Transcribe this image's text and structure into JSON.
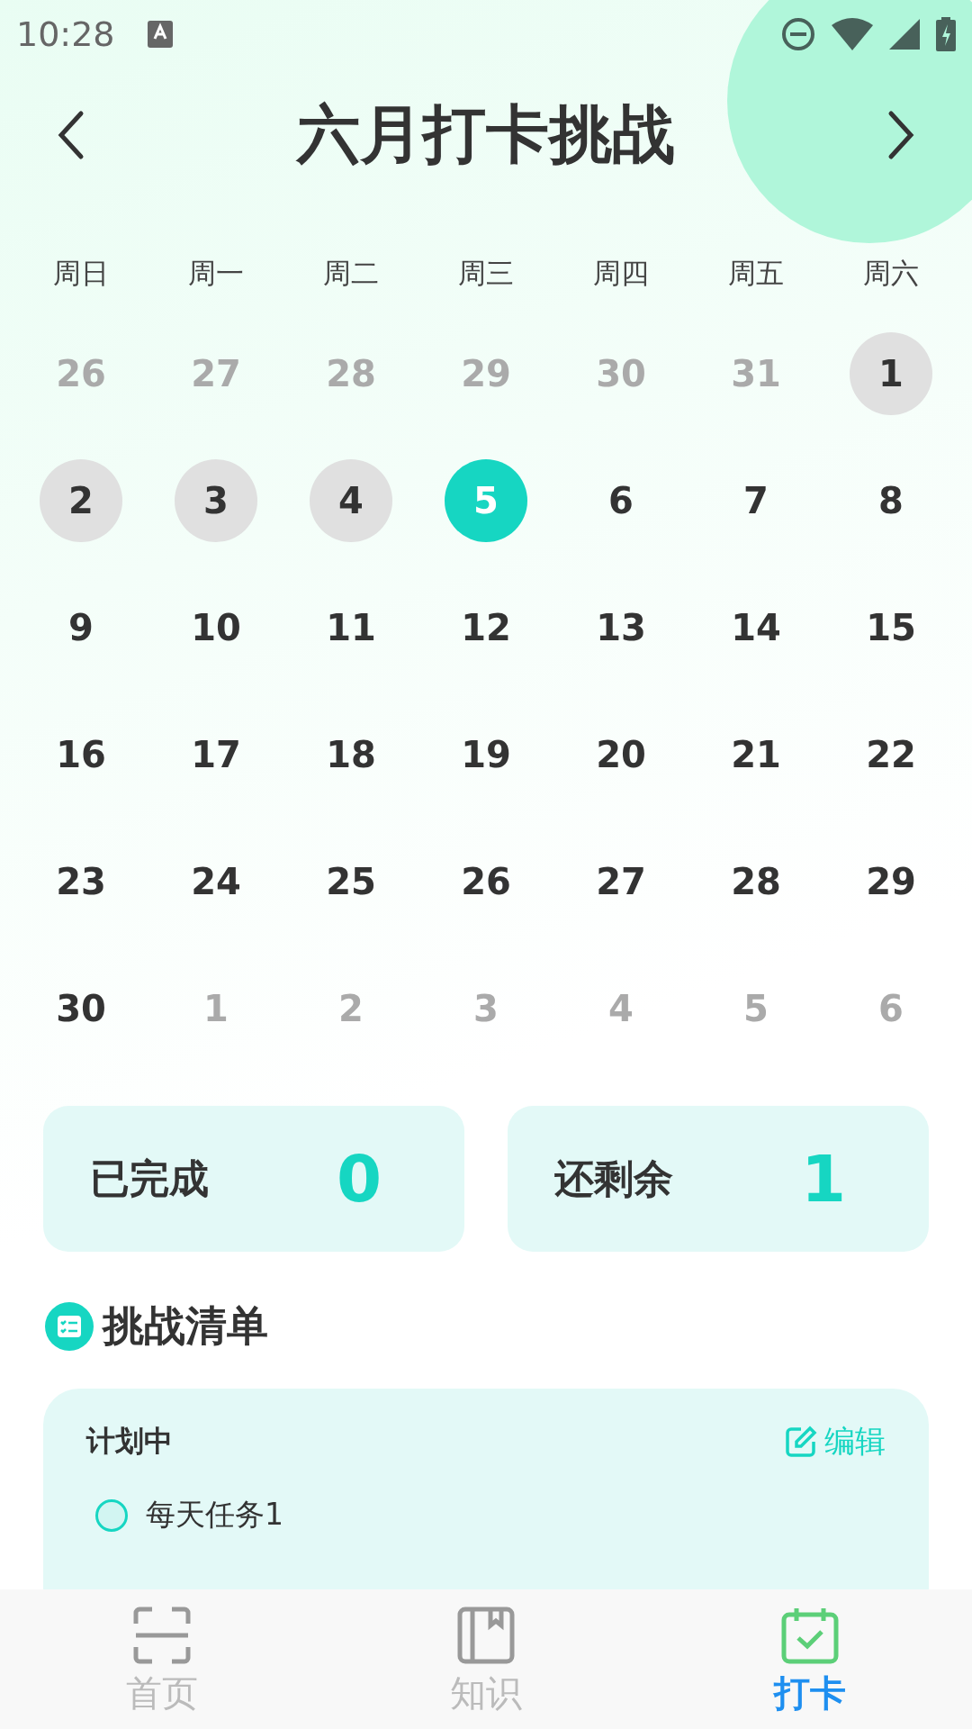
{
  "status_bar": {
    "time": "10:28"
  },
  "header": {
    "title": "六月打卡挑战"
  },
  "weekdays": [
    "周日",
    "周一",
    "周二",
    "周三",
    "周四",
    "周五",
    "周六"
  ],
  "weeks": [
    [
      {
        "label": "26",
        "kind": "outside"
      },
      {
        "label": "27",
        "kind": "outside"
      },
      {
        "label": "28",
        "kind": "outside"
      },
      {
        "label": "29",
        "kind": "outside"
      },
      {
        "label": "30",
        "kind": "outside"
      },
      {
        "label": "31",
        "kind": "outside"
      },
      {
        "label": "1",
        "kind": "done"
      }
    ],
    [
      {
        "label": "2",
        "kind": "done"
      },
      {
        "label": "3",
        "kind": "done"
      },
      {
        "label": "4",
        "kind": "done"
      },
      {
        "label": "5",
        "kind": "today"
      },
      {
        "label": "6",
        "kind": "plain"
      },
      {
        "label": "7",
        "kind": "plain"
      },
      {
        "label": "8",
        "kind": "plain"
      }
    ],
    [
      {
        "label": "9",
        "kind": "plain"
      },
      {
        "label": "10",
        "kind": "plain"
      },
      {
        "label": "11",
        "kind": "plain"
      },
      {
        "label": "12",
        "kind": "plain"
      },
      {
        "label": "13",
        "kind": "plain"
      },
      {
        "label": "14",
        "kind": "plain"
      },
      {
        "label": "15",
        "kind": "plain"
      }
    ],
    [
      {
        "label": "16",
        "kind": "plain"
      },
      {
        "label": "17",
        "kind": "plain"
      },
      {
        "label": "18",
        "kind": "plain"
      },
      {
        "label": "19",
        "kind": "plain"
      },
      {
        "label": "20",
        "kind": "plain"
      },
      {
        "label": "21",
        "kind": "plain"
      },
      {
        "label": "22",
        "kind": "plain"
      }
    ],
    [
      {
        "label": "23",
        "kind": "plain"
      },
      {
        "label": "24",
        "kind": "plain"
      },
      {
        "label": "25",
        "kind": "plain"
      },
      {
        "label": "26",
        "kind": "plain"
      },
      {
        "label": "27",
        "kind": "plain"
      },
      {
        "label": "28",
        "kind": "plain"
      },
      {
        "label": "29",
        "kind": "plain"
      }
    ],
    [
      {
        "label": "30",
        "kind": "plain"
      },
      {
        "label": "1",
        "kind": "outside"
      },
      {
        "label": "2",
        "kind": "outside"
      },
      {
        "label": "3",
        "kind": "outside"
      },
      {
        "label": "4",
        "kind": "outside"
      },
      {
        "label": "5",
        "kind": "outside"
      },
      {
        "label": "6",
        "kind": "outside"
      }
    ]
  ],
  "stats": [
    {
      "label": "已完成",
      "value": "0"
    },
    {
      "label": "还剩余",
      "value": "1"
    }
  ],
  "checklist": {
    "title": "挑战清单",
    "group": "计划中",
    "edit": "编辑",
    "tasks": [
      {
        "label": "每天任务1",
        "checked": false
      }
    ]
  },
  "tabs": [
    {
      "label": "首页",
      "kind": "scan",
      "selected": false
    },
    {
      "label": "知识",
      "kind": "book",
      "selected": false
    },
    {
      "label": "打卡",
      "kind": "calendar",
      "selected": true
    }
  ]
}
